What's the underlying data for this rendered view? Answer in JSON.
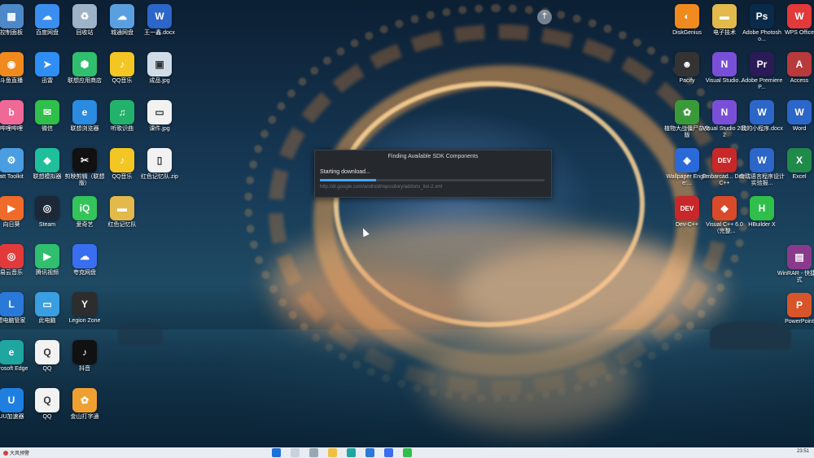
{
  "dialog": {
    "title": "Finding Available SDK Components",
    "status": "Starting download...",
    "url": "http://dl.google.com/android/repository/addons_list-2.xml",
    "progress": 0.25
  },
  "desktop": {
    "left_icons": [
      {
        "label": "控制面板",
        "glyph": "▦",
        "color": "#4d88c9"
      },
      {
        "label": "百度网盘",
        "glyph": "☁",
        "color": "#3a8ef0"
      },
      {
        "label": "回收站",
        "glyph": "♻",
        "color": "#9fb3c8"
      },
      {
        "label": "城通网盘",
        "glyph": "☁",
        "color": "#5aa0e0"
      },
      {
        "label": "王一鑫.docx",
        "glyph": "W",
        "color": "#2b66c8"
      },
      {
        "label": "斗鱼直播",
        "glyph": "◉",
        "color": "#f08a1e"
      },
      {
        "label": "迅雷",
        "glyph": "➤",
        "color": "#2f8ef4"
      },
      {
        "label": "联想应用商店",
        "glyph": "⬢",
        "color": "#2fbf6e"
      },
      {
        "label": "QQ音乐",
        "glyph": "♪",
        "color": "#f3c623"
      },
      {
        "label": "成品.jpg",
        "glyph": "▣",
        "color": "#d0dde8"
      },
      {
        "label": "哔哩哔哩",
        "glyph": "b",
        "color": "#f06895"
      },
      {
        "label": "微信",
        "glyph": "✉",
        "color": "#2fbf4a"
      },
      {
        "label": "联想浏览器",
        "glyph": "e",
        "color": "#2a8be0"
      },
      {
        "label": "听歌识曲",
        "glyph": "♫",
        "color": "#23b26b"
      },
      {
        "label": "课件.jpg",
        "glyph": "▭",
        "color": "#f2f2f2"
      },
      {
        "label": "att Toolkit",
        "glyph": "⚙",
        "color": "#4a9de0"
      },
      {
        "label": "联想模拟器",
        "glyph": "◆",
        "color": "#1fbf9b"
      },
      {
        "label": "剪映剪辑（联想版）",
        "glyph": "✂",
        "color": "#111111"
      },
      {
        "label": "QQ音乐",
        "glyph": "♪",
        "color": "#f3c623"
      },
      {
        "label": "红色记忆队.zip",
        "glyph": "▯",
        "color": "#f2f2f2"
      },
      {
        "label": "向日葵",
        "glyph": "▶",
        "color": "#f06a2a"
      },
      {
        "label": "Steam",
        "glyph": "◎",
        "color": "#1b2838"
      },
      {
        "label": "爱奇艺",
        "glyph": "iQ",
        "color": "#33c45a"
      },
      {
        "label": "红色记忆队",
        "glyph": "▬",
        "color": "#e2b94a"
      },
      {
        "label": "易云音乐",
        "glyph": "◎",
        "color": "#e23a3a"
      },
      {
        "label": "腾讯视频",
        "glyph": "▶",
        "color": "#2fbf6e"
      },
      {
        "label": "夸克网盘",
        "glyph": "☁",
        "color": "#3a6ef0"
      },
      {
        "label": "想电脑管家",
        "glyph": "L",
        "color": "#2a78d8"
      },
      {
        "label": "此电脑",
        "glyph": "▭",
        "color": "#3a9ee0"
      },
      {
        "label": "Legion Zone",
        "glyph": "Y",
        "color": "#2d2d2d"
      },
      {
        "label": "icrosoft Edge",
        "glyph": "e",
        "color": "#1fa6a0"
      },
      {
        "label": "QQ",
        "glyph": "Q",
        "color": "#f2f2f2"
      },
      {
        "label": "抖音",
        "glyph": "♪",
        "color": "#111111"
      },
      {
        "label": "UU加速器",
        "glyph": "U",
        "color": "#1f7fe0"
      },
      {
        "label": "QQ",
        "glyph": "Q",
        "color": "#f2f2f2"
      },
      {
        "label": "金山打字通",
        "glyph": "✿",
        "color": "#f0a030"
      }
    ],
    "right_icons": [
      {
        "label": "DiskGenius",
        "glyph": "◐",
        "color": "#f08a1e"
      },
      {
        "label": "电子技术",
        "glyph": "▬",
        "color": "#e2b94a"
      },
      {
        "label": "Adobe Photosho...",
        "glyph": "Ps",
        "color": "#0a2a4a"
      },
      {
        "label": "WPS Office",
        "glyph": "W",
        "color": "#e23a3a"
      },
      {
        "label": "Pacify",
        "glyph": "☻",
        "color": "#333333"
      },
      {
        "label": "Visual Studio...",
        "glyph": "N",
        "color": "#7a4fd8"
      },
      {
        "label": "Adobe Premiere P...",
        "glyph": "Pr",
        "color": "#2a1a55"
      },
      {
        "label": "Access",
        "glyph": "A",
        "color": "#b83a3a"
      },
      {
        "label": "植物大战僵尸杂交版",
        "glyph": "✿",
        "color": "#3a9a3a"
      },
      {
        "label": "Visual Studio 2022",
        "glyph": "N",
        "color": "#7a4fd8"
      },
      {
        "label": "我的小程序.docx",
        "glyph": "W",
        "color": "#2b66c8"
      },
      {
        "label": "Word",
        "glyph": "W",
        "color": "#2b66c8"
      },
      {
        "label": "Wallpaper Engine:...",
        "glyph": "◈",
        "color": "#2a6ad8"
      },
      {
        "label": "Embarcad... Dev-C++",
        "glyph": "DEV",
        "color": "#c8282a"
      },
      {
        "label": "南瑞语言程序设计实验报...",
        "glyph": "W",
        "color": "#2b66c8"
      },
      {
        "label": "Excel",
        "glyph": "X",
        "color": "#1f8a4a"
      },
      {
        "label": "Dev-C++",
        "glyph": "DEV",
        "color": "#c8282a"
      },
      {
        "label": "Visual C++ 6.0（完整...",
        "glyph": "◆",
        "color": "#d84a2a"
      },
      {
        "label": "HBuilder X",
        "glyph": "H",
        "color": "#2fbf4a"
      },
      {
        "label": "WinRAR - 快捷方式",
        "glyph": "▤",
        "color": "#8a3a8a"
      },
      {
        "label": "PowerPoint",
        "glyph": "P",
        "color": "#d8542a"
      }
    ]
  },
  "taskbar": {
    "weather": "大风预警",
    "clock": "23:51"
  }
}
